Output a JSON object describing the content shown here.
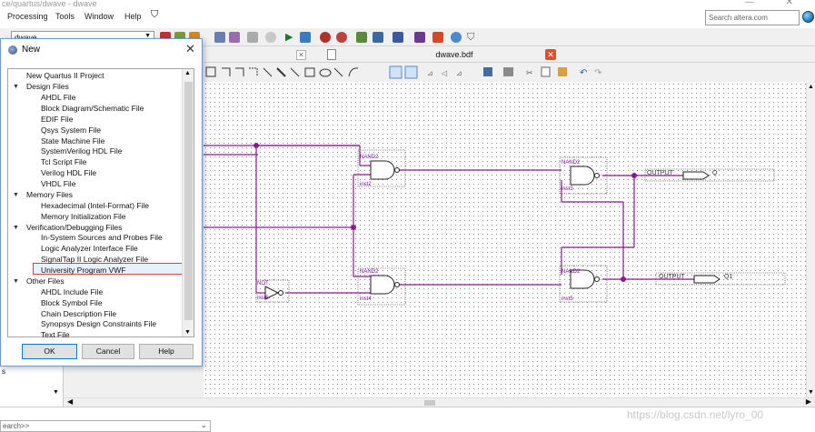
{
  "window": {
    "title": "ce/quartus/dwave - dwave",
    "controls": "—  ✕"
  },
  "menu": {
    "items": [
      "Processing",
      "Tools",
      "Window",
      "Help"
    ],
    "search_placeholder": "Search altera.com"
  },
  "toolbar": {
    "project_combo": "dwave"
  },
  "tabs": {
    "active": "dwave.bdf",
    "close_glyph": "✕",
    "inactive_close_glyph": "✕"
  },
  "dialog": {
    "title": "New",
    "close_glyph": "✕",
    "tree": [
      {
        "label": "New Quartus II Project",
        "level": 0
      },
      {
        "label": "Design Files",
        "level": 0,
        "expanded": true
      },
      {
        "label": "AHDL File",
        "level": 1
      },
      {
        "label": "Block Diagram/Schematic File",
        "level": 1
      },
      {
        "label": "EDIF File",
        "level": 1
      },
      {
        "label": "Qsys System File",
        "level": 1
      },
      {
        "label": "State Machine File",
        "level": 1
      },
      {
        "label": "SystemVerilog HDL File",
        "level": 1
      },
      {
        "label": "Tcl Script File",
        "level": 1
      },
      {
        "label": "Verilog HDL File",
        "level": 1
      },
      {
        "label": "VHDL File",
        "level": 1
      },
      {
        "label": "Memory Files",
        "level": 0,
        "expanded": true
      },
      {
        "label": "Hexadecimal (Intel-Format) File",
        "level": 1
      },
      {
        "label": "Memory Initialization File",
        "level": 1
      },
      {
        "label": "Verification/Debugging Files",
        "level": 0,
        "expanded": true
      },
      {
        "label": "In-System Sources and Probes File",
        "level": 1
      },
      {
        "label": "Logic Analyzer Interface File",
        "level": 1
      },
      {
        "label": "SignalTap II Logic Analyzer File",
        "level": 1
      },
      {
        "label": "University Program VWF",
        "level": 1,
        "selected": true
      },
      {
        "label": "Other Files",
        "level": 0,
        "expanded": true
      },
      {
        "label": "AHDL Include File",
        "level": 1
      },
      {
        "label": "Block Symbol File",
        "level": 1
      },
      {
        "label": "Chain Description File",
        "level": 1
      },
      {
        "label": "Synopsys Design Constraints File",
        "level": 1
      },
      {
        "label": "Text File",
        "level": 1
      }
    ],
    "buttons": {
      "ok": "OK",
      "cancel": "Cancel",
      "help": "Help"
    }
  },
  "schematic": {
    "gates": [
      {
        "type": "NAND2",
        "inst": "inst2"
      },
      {
        "type": "NAND2",
        "inst": "inst3"
      },
      {
        "type": "NAND2",
        "inst": "inst4"
      },
      {
        "type": "NAND2",
        "inst": "inst5"
      },
      {
        "type": "NOT",
        "inst": "inst6"
      }
    ],
    "outputs": [
      {
        "kind": "OUTPUT",
        "name": "Q"
      },
      {
        "kind": "OUTPUT",
        "name": "Q1"
      }
    ],
    "wire_color": "#8b1a8b"
  },
  "bottom": {
    "search_more": "earch>>",
    "watermark": "https://blog.csdn.net/lyro_00",
    "left_pane_letter": "s"
  },
  "colors": {
    "accent": "#0078d7",
    "selection_border": "#e03c3c",
    "close_red": "#e0502a"
  }
}
